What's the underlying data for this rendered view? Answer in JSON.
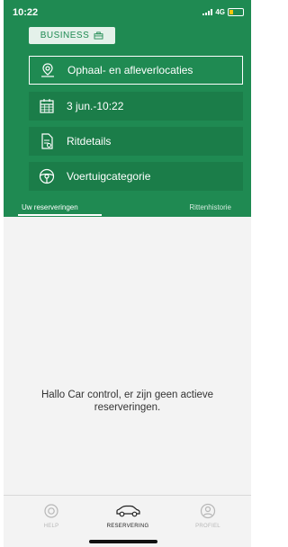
{
  "status_bar": {
    "time": "10:22",
    "network": "4G"
  },
  "badge": {
    "label": "BUSINESS",
    "icon": "briefcase-icon"
  },
  "menu": [
    {
      "label": "Ophaal- en afleverlocaties",
      "icon": "map-pin-icon"
    },
    {
      "label": "3 jun.-10:22",
      "icon": "calendar-icon"
    },
    {
      "label": "Ritdetails",
      "icon": "document-icon"
    },
    {
      "label": "Voertuigcategorie",
      "icon": "steering-wheel-icon"
    }
  ],
  "tabs": {
    "active": "Uw reserveringen",
    "inactive": "Rittenhistorie"
  },
  "content": {
    "empty_message": "Hallo Car control, er zijn geen actieve reserveringen."
  },
  "bottom_nav": {
    "help": "HELP",
    "reservering": "RESERVERING",
    "profiel": "PROFIEL"
  },
  "colors": {
    "brand_green": "#1f8a52",
    "battery_yellow": "#f7c60b"
  }
}
